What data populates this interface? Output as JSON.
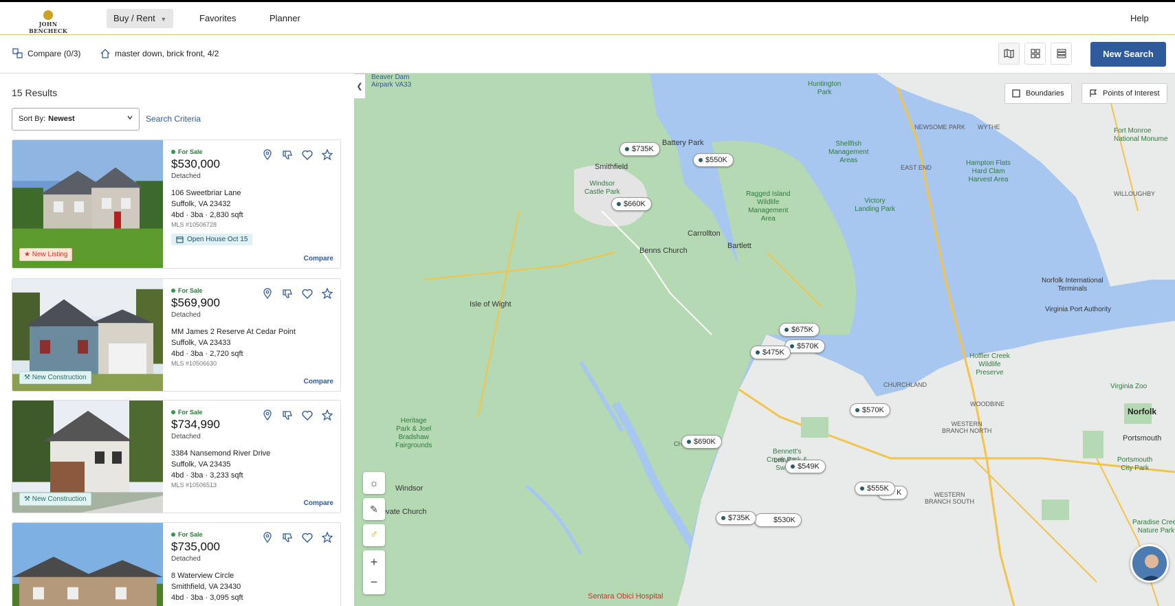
{
  "brand": {
    "name": "JOHN BENCHECK"
  },
  "nav": {
    "buy_rent": "Buy / Rent",
    "favorites": "Favorites",
    "planner": "Planner",
    "help": "Help"
  },
  "toolbar": {
    "compare": "Compare (0/3)",
    "search_name": "master down, brick front, 4/2",
    "new_search": "New Search"
  },
  "sidebar": {
    "results_count": "15 Results",
    "sort_label": "Sort By:",
    "sort_value": "Newest",
    "search_criteria": "Search Criteria"
  },
  "listings": [
    {
      "status": "For Sale",
      "price": "$530,000",
      "type": "Detached",
      "address1": "106 Sweetbriar Lane",
      "address2": "Suffolk, VA 23432",
      "beds": "4bd",
      "baths": "3ba",
      "sqft": "2,830 sqft",
      "mls": "MLS #10506728",
      "open_house": "Open House Oct 15",
      "badge": "New Listing",
      "compare": "Compare"
    },
    {
      "status": "For Sale",
      "price": "$569,900",
      "type": "Detached",
      "address1": "MM James 2 Reserve At Cedar Point",
      "address2": "Suffolk, VA 23433",
      "beds": "4bd",
      "baths": "3ba",
      "sqft": "2,720 sqft",
      "mls": "MLS #10506630",
      "badge": "New Construction",
      "compare": "Compare"
    },
    {
      "status": "For Sale",
      "price": "$734,990",
      "type": "Detached",
      "address1": "3384 Nansemond River Drive",
      "address2": "Suffolk, VA 23435",
      "beds": "4bd",
      "baths": "3ba",
      "sqft": "3,233 sqft",
      "mls": "MLS #10506513",
      "badge": "New Construction",
      "compare": "Compare"
    },
    {
      "status": "For Sale",
      "price": "$735,000",
      "type": "Detached",
      "address1": "8 Waterview Circle",
      "address2": "Smithfield, VA 23430",
      "beds": "4bd",
      "baths": "3ba",
      "sqft": "3,095 sqft"
    }
  ],
  "map": {
    "chips": {
      "boundaries": "Boundaries",
      "poi": "Points of Interest"
    },
    "zoom_in": "+",
    "zoom_out": "−",
    "pins": [
      "$735K",
      "$550K",
      "$660K",
      "$675K",
      "$570K",
      "$475K",
      "$570K",
      "$690K",
      "$549K",
      "$555K",
      "K",
      "$735K",
      "$530K"
    ],
    "places": {
      "smithfield": "Smithfield",
      "battery_park": "Battery Park",
      "carrollton": "Carrollton",
      "bartlett": "Bartlett",
      "benns_church": "Benns Church",
      "isle_of_wight": "Isle of Wight",
      "windsor": "Windsor",
      "chuckatuck": "CHUCKATUCK",
      "driver": "DRIVER",
      "norfolk": "Norfolk",
      "portsmouth": "Portsmouth",
      "churchland": "CHURCHLAND",
      "woodbine": "WOODBINE",
      "western_branch_north": "WESTERN\nBRANCH NORTH",
      "western_branch_south": "WESTERN\nBRANCH SOUTH",
      "east_end": "EAST END",
      "wythe": "WYTHE",
      "newsome_park": "NEWSOME PARK",
      "huntington_park": "Huntington\nPark",
      "shellfish": "Shellfish\nManagement\nAreas",
      "ragged_island": "Ragged Island\nWildlife\nManagement\nArea",
      "victory_landing": "Victory\nLanding Park",
      "hampton_flats": "Hampton Flats\nHard Clam\nHarvest Area",
      "fort_monroe": "Fort Monroe\nNational Monume",
      "norfolk_airport": "Norfolk International\nTerminals",
      "virginia_port": "Virginia Port Authority",
      "hoffler_creek": "Hoffler Creek\nWildlife\nPreserve",
      "bennetts_creek": "Bennett's\nCreek Park &\nSwamp",
      "heritage_park": "Heritage\nPark & Joel\nBradshaw\nFairgrounds",
      "windsor_castle": "Windsor\nCastle Park",
      "portsmouth_city_park": "Portsmouth\nCity Park",
      "paradise_creek": "Paradise Creek\nNature Park",
      "virginia_zoo": "Virginia Zoo",
      "sentara": "Sentara Obici Hospital",
      "beaver_dam": "Beaver Dam\nAirpark VA33",
      "elevate_church": "evate Church",
      "wyndham": "WILLOUGHBY"
    }
  },
  "colors": {
    "accent": "#2f5a9b",
    "land": "#e9eaea",
    "park": "#b5d9b3",
    "water": "#a8c7f0"
  }
}
